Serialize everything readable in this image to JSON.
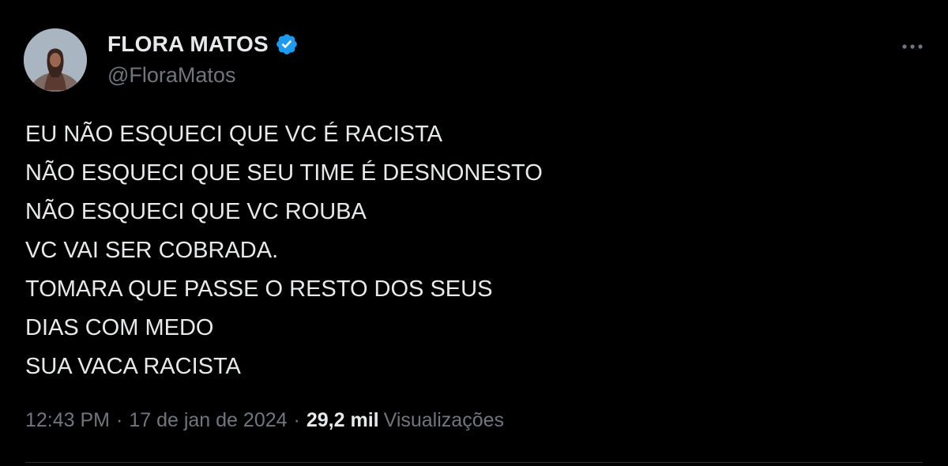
{
  "author": {
    "display_name": "FLORA MATOS",
    "handle": "@FloraMatos",
    "verified": true,
    "avatar_icon": "profile-photo"
  },
  "tweet": {
    "lines": [
      "EU NÃO ESQUECI QUE VC É RACISTA",
      "NÃO ESQUECI QUE SEU TIME É DESNONESTO",
      "NÃO ESQUECI QUE VC ROUBA",
      "VC VAI SER COBRADA.",
      "TOMARA QUE PASSE O RESTO DOS SEUS",
      "DIAS COM MEDO",
      "SUA VACA RACISTA"
    ]
  },
  "meta": {
    "time": "12:43 PM",
    "separator": "·",
    "date": "17 de jan de 2024",
    "views_count": "29,2 mil",
    "views_label": "Visualizações"
  },
  "colors": {
    "background": "#000000",
    "text_primary": "#e7e9ea",
    "text_secondary": "#71767b",
    "verified_blue": "#1d9bf0"
  }
}
